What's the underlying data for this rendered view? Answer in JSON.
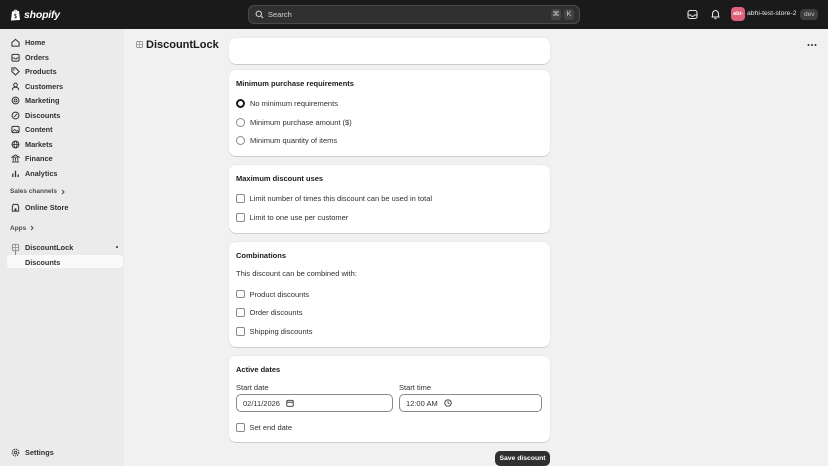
{
  "topbar": {
    "logo_text": "shopify",
    "search_placeholder": "Search",
    "shortcut_keys": [
      "⌘",
      "K"
    ],
    "store_initials": "abi-",
    "store_name": "abhi-test-store-2",
    "env_badge": "dev"
  },
  "sidebar": {
    "items": [
      {
        "label": "Home",
        "icon": "home-icon"
      },
      {
        "label": "Orders",
        "icon": "orders-icon"
      },
      {
        "label": "Products",
        "icon": "tag-icon"
      },
      {
        "label": "Customers",
        "icon": "person-icon"
      },
      {
        "label": "Marketing",
        "icon": "target-icon"
      },
      {
        "label": "Discounts",
        "icon": "discount-icon"
      },
      {
        "label": "Content",
        "icon": "content-icon"
      },
      {
        "label": "Markets",
        "icon": "globe-icon"
      },
      {
        "label": "Finance",
        "icon": "bank-icon"
      },
      {
        "label": "Analytics",
        "icon": "chart-icon"
      }
    ],
    "sales_channels_heading": "Sales channels",
    "online_store": "Online Store",
    "apps_heading": "Apps",
    "app_name": "DiscountLock",
    "app_sub_item": "Discounts",
    "settings": "Settings"
  },
  "page": {
    "title": "DiscountLock"
  },
  "min_requirements": {
    "title": "Minimum purchase requirements",
    "options": [
      {
        "label": "No minimum requirements",
        "checked": true
      },
      {
        "label": "Minimum purchase amount ($)",
        "checked": false
      },
      {
        "label": "Minimum quantity of items",
        "checked": false
      }
    ]
  },
  "max_uses": {
    "title": "Maximum discount uses",
    "options": [
      {
        "label": "Limit number of times this discount can be used in total",
        "checked": false
      },
      {
        "label": "Limit to one use per customer",
        "checked": false
      }
    ]
  },
  "combinations": {
    "title": "Combinations",
    "description": "This discount can be combined with:",
    "options": [
      {
        "label": "Product discounts",
        "checked": false
      },
      {
        "label": "Order discounts",
        "checked": false
      },
      {
        "label": "Shipping discounts",
        "checked": false
      }
    ]
  },
  "active_dates": {
    "title": "Active dates",
    "start_date_label": "Start date",
    "start_date_value": "02/11/2026",
    "start_time_label": "Start time",
    "start_time_value": "12:00  AM",
    "end_date_label": "Set end date"
  },
  "footer": {
    "save_label": "Save discount"
  }
}
